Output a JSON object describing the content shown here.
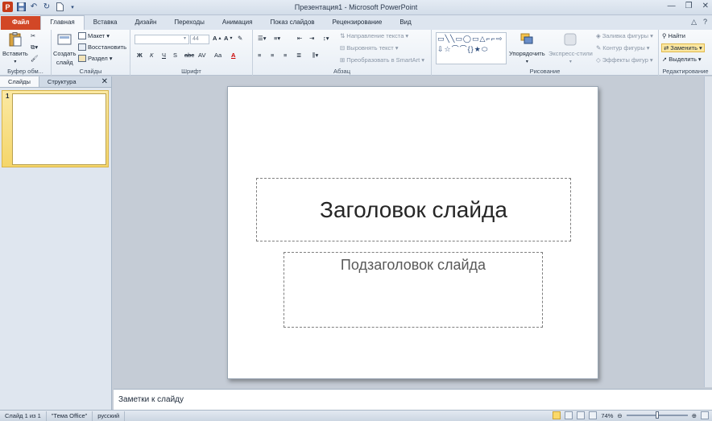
{
  "window": {
    "title": "Презентация1 - Microsoft PowerPoint"
  },
  "tabs": {
    "file": "Файл",
    "items": [
      "Главная",
      "Вставка",
      "Дизайн",
      "Переходы",
      "Анимация",
      "Показ слайдов",
      "Рецензирование",
      "Вид"
    ],
    "active": "Главная"
  },
  "ribbon": {
    "clipboard": {
      "label": "Буфер обм...",
      "paste": "Вставить"
    },
    "slides": {
      "label": "Слайды",
      "new_slide_1": "Создать",
      "new_slide_2": "слайд",
      "layout": "Макет",
      "reset": "Восстановить",
      "section": "Раздел"
    },
    "font": {
      "label": "Шрифт",
      "font_name": "",
      "font_size": "44",
      "bold": "Ж",
      "italic": "К",
      "underline": "Ч",
      "shadow": "S",
      "strike": "abc",
      "spacing": "AV",
      "case": "Aa",
      "color": "A"
    },
    "paragraph": {
      "label": "Абзац",
      "text_direction": "Направление текста",
      "align_text": "Выровнять текст",
      "smartart": "Преобразовать в SmartArt"
    },
    "drawing": {
      "label": "Рисование",
      "arrange": "Упорядочить",
      "quick_styles": "Экспресс-стили",
      "fill": "Заливка фигуры",
      "outline": "Контур фигуры",
      "effects": "Эффекты фигур"
    },
    "editing": {
      "label": "Редактирование",
      "find": "Найти",
      "replace": "Заменить",
      "select": "Выделить"
    }
  },
  "left_panel": {
    "tabs": [
      "Слайды",
      "Структура"
    ],
    "active_tab": "Слайды",
    "slide_number": "1"
  },
  "slide": {
    "title_placeholder": "Заголовок слайда",
    "subtitle_placeholder": "Подзаголовок слайда"
  },
  "notes": {
    "placeholder": "Заметки к слайду"
  },
  "status": {
    "slide_info": "Слайд 1 из 1",
    "theme": "\"Тема Office\"",
    "language": "русский",
    "zoom": "74%"
  },
  "colors": {
    "file_tab": "#d24726",
    "selected_thumb": "#f5d66a"
  }
}
